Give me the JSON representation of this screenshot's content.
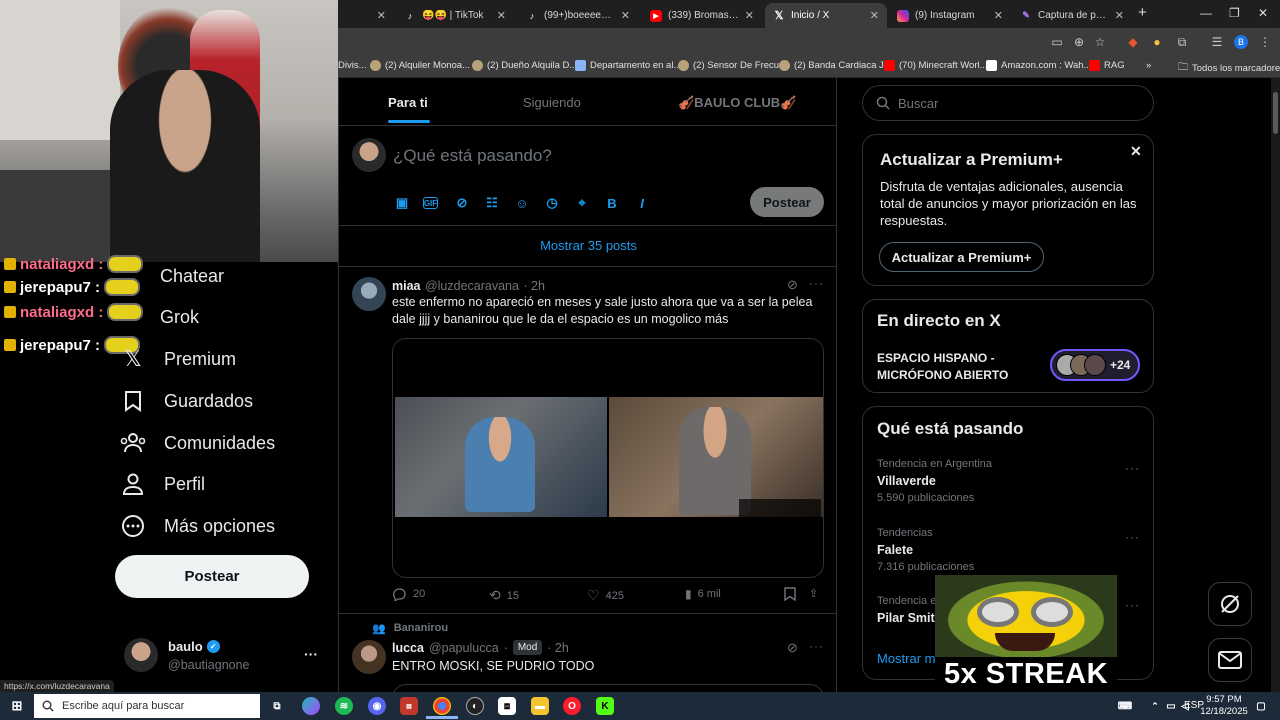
{
  "browser": {
    "tabs": [
      {
        "label": "",
        "icon": "tab-icon-generic"
      },
      {
        "label": "😝😝 | TikTok",
        "icon": "tiktok-icon"
      },
      {
        "label": "(99+)boeeeeeee #fyp",
        "icon": "tiktok-icon"
      },
      {
        "label": "(339) Bromas con Ga",
        "icon": "youtube-icon"
      },
      {
        "label": "Inicio / X",
        "icon": "x-icon"
      },
      {
        "label": "(9) Instagram",
        "icon": "instagram-icon"
      },
      {
        "label": "Captura de pantalla",
        "icon": "pen-icon"
      }
    ],
    "bookmarks": [
      {
        "label": "Divis..."
      },
      {
        "label": "(2) Alquiler Monoa..."
      },
      {
        "label": "(2) Dueño Alquila D..."
      },
      {
        "label": "Departamento en al..."
      },
      {
        "label": "(2) Sensor De Frecu..."
      },
      {
        "label": "(2) Banda Cardiaca J..."
      },
      {
        "label": "(70) Minecraft Worl..."
      },
      {
        "label": "Amazon.com : Wah..."
      },
      {
        "label": "RAG"
      }
    ],
    "all_bookmarks": "Todos los marcadores",
    "status_url": "https://x.com/luzdecaravana",
    "profile_initial": "B"
  },
  "stream_chat": [
    {
      "user": "nataliagxd :",
      "color": "#ff6b8b"
    },
    {
      "user": "jerepapu7 :",
      "color": "#ffffff"
    },
    {
      "user": "nataliagxd :",
      "color": "#ff6b8b"
    },
    {
      "user": "jerepapu7 :",
      "color": "#ffffff"
    }
  ],
  "nav": {
    "items": [
      {
        "label": "Chatear",
        "icon": "chat-icon"
      },
      {
        "label": "Grok",
        "icon": "grok-icon"
      },
      {
        "label": "Premium",
        "icon": "x-logo-icon"
      },
      {
        "label": "Guardados",
        "icon": "bookmark-icon"
      },
      {
        "label": "Comunidades",
        "icon": "communities-icon"
      },
      {
        "label": "Perfil",
        "icon": "profile-icon"
      },
      {
        "label": "Más opciones",
        "icon": "more-icon"
      }
    ],
    "post_button": "Postear"
  },
  "account": {
    "name": "baulo",
    "handle": "@bautiagnone",
    "more": "···"
  },
  "feed": {
    "tabs": [
      "Para ti",
      "Siguiendo",
      "🎻BAULO CLUB🎻"
    ],
    "compose_placeholder": "¿Qué está pasando?",
    "compose_post_button": "Postear",
    "show_more": "Mostrar 35 posts",
    "tweets": [
      {
        "name": "miaa",
        "handle": "@luzdecaravana",
        "time": "· 2h",
        "text": "este enfermo no apareció en meses y sale justo ahora que va a ser la pelea dale jjjj y bananirou que le da el espacio es un mogolico más",
        "replies": "20",
        "reposts": "15",
        "likes": "425",
        "views": "6 mil"
      },
      {
        "context": "Bananirou",
        "name": "lucca",
        "handle": "@papulucca",
        "badge": "Mod",
        "time": "· 2h",
        "text": "ENTRO MOSKI, SE PUDRIO TODO"
      }
    ]
  },
  "sidebar": {
    "search_placeholder": "Buscar",
    "premium": {
      "title": "Actualizar a Premium+",
      "desc": "Disfruta de ventajas adicionales, ausencia total de anuncios y mayor priorización en las respuestas.",
      "button": "Actualizar a Premium+"
    },
    "live": {
      "title": "En directo en X",
      "space_name": "ESPACIO HISPANO - MICRÓFONO ABIERTO",
      "listeners": "+24"
    },
    "trends": {
      "title": "Qué está pasando",
      "items": [
        {
          "context": "Tendencia en Argentina",
          "name": "Villaverde",
          "count": "5.590 publicaciones"
        },
        {
          "context": "Tendencias",
          "name": "Falete",
          "count": "7.316 publicaciones"
        },
        {
          "context": "Tendencia e",
          "name": "Pilar Smit",
          "count": ""
        }
      ],
      "show_more": "Mostrar más"
    }
  },
  "overlay": {
    "streak": "5x STREAK"
  },
  "taskbar": {
    "search_placeholder": "Escribe aquí para buscar",
    "lang": "ESP",
    "time": "9:57 PM",
    "date": "12/18/2025"
  }
}
